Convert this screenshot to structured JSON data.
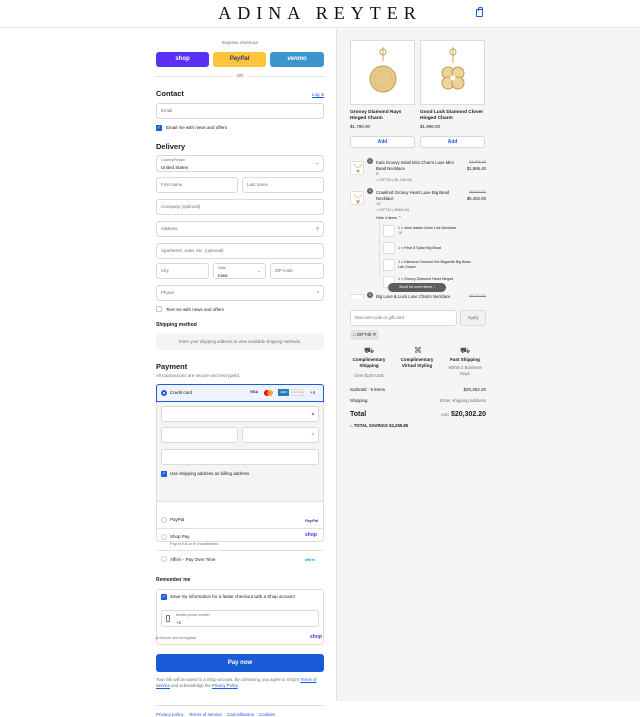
{
  "header": {
    "logo": "ADINA REYTER"
  },
  "express": {
    "label": "Express checkout",
    "shop": "shop",
    "paypal": "PayPal",
    "venmo": "venmo",
    "or": "OR"
  },
  "contact": {
    "title": "Contact",
    "login": "Log in",
    "email_placeholder": "Email",
    "news_label": "Email me with news and offers"
  },
  "delivery": {
    "title": "Delivery",
    "country_label": "Country/Region",
    "country_value": "United States",
    "first_name": "First name",
    "last_name": "Last name",
    "company": "Company (optional)",
    "address": "Address",
    "apartment": "Apartment, suite, etc. (optional)",
    "city": "City",
    "state_label": "State",
    "state_value": "Iowa",
    "zip": "ZIP code",
    "phone": "Phone",
    "text_label": "Text me with news and offers"
  },
  "shipping": {
    "title": "Shipping method",
    "notice": "Enter your shipping address to view available shipping methods."
  },
  "payment": {
    "title": "Payment",
    "subtitle": "All transactions are secure and encrypted.",
    "credit_card": "Credit card",
    "card_more": "+4",
    "billing_label": "Use shipping address as billing address",
    "paypal": "PayPal",
    "shop_pay": "Shop Pay",
    "shop_pay_sub": "Pay in full or in installments",
    "affirm": "Affirm - Pay Over Time",
    "brands": {
      "visa": "VISA",
      "amex": "AMEX",
      "discover": "DISCOVER",
      "shop": "shop",
      "affirm": "affirm"
    }
  },
  "remember": {
    "title": "Remember me",
    "save_label": "Save my information for a faster checkout with a Shop account",
    "mobile_label": "Mobile phone number",
    "mobile_value": "+1",
    "secure": "Secure and encrypted",
    "shop_brand": "shop"
  },
  "pay": {
    "label": "Pay now",
    "legal_1": "Your info will be saved to a Shop account. By continuing, you agree to Shop's",
    "terms": "Terms of Service",
    "legal_2": "and acknowledge the",
    "privacy": "Privacy Policy",
    "legal_end": "."
  },
  "footer": {
    "links": [
      "Privacy policy",
      "Terms of service",
      "Cancellations",
      "Cookies"
    ]
  },
  "upsells": [
    {
      "name": "Groovy Diamond Rays Hinged Charm",
      "price": "$1,798.00",
      "add": "Add"
    },
    {
      "name": "Good Luck Diamond Clover Hinged Charm",
      "price": "$1,998.00",
      "add": "Add"
    }
  ],
  "cart": [
    {
      "qty": "1",
      "name": "Kaia Groovy Initial Mini Charm Luxe Mini Bead Necklace",
      "variant": "B",
      "discount": "GIFT40 (-$1,208.00)",
      "old": "$3,098.00",
      "price": "$1,886.40"
    },
    {
      "qty": "1",
      "name": "Crawford Groovy Heart Luxe Big Bead Necklace",
      "variant": "16\"",
      "discount": "GIFT40 (-$968.20)",
      "old": "$6,553.00",
      "price": "$5,482.80"
    }
  ],
  "bundle": {
    "hide": "Hide 4 items",
    "items": [
      {
        "name": "1 × 4mm Italian Chain Link Necklace",
        "sub": "16\""
      },
      {
        "name": "1 × Pavé 8 Spike Big Bead",
        "sub": ""
      },
      {
        "name": "1 × Diamond Channel-Set Baguette Big Bead - Lab Grown",
        "sub": ""
      },
      {
        "name": "1 × Groovy Diamond Heart Hinged",
        "sub": ""
      }
    ],
    "scroll": "Scroll for more items"
  },
  "cart_last": {
    "qty": "1",
    "name": "Big Love & Luck Luxe Charm Necklace",
    "old": "$5,263.00"
  },
  "discount": {
    "placeholder": "Discount code or gift card",
    "apply": "Apply",
    "chip": "GIFT40"
  },
  "benefits": [
    {
      "title": "Complimentary Shipping",
      "sub": "Over $100 USD"
    },
    {
      "title": "Complimentary Virtual Styling",
      "sub": ""
    },
    {
      "title": "Fast Shipping",
      "sub": "Within 2 Business Days"
    }
  ],
  "summary": {
    "subtotal_label": "Subtotal · 5 items",
    "subtotal": "$20,302.20",
    "shipping_label": "Shipping",
    "shipping": "Enter shipping address",
    "total_label": "Total",
    "currency": "USD",
    "total": "$20,302.20",
    "savings_label": "TOTAL SAVINGS",
    "savings": "$2,255.80"
  },
  "colors": {
    "accent": "#1a5bd8",
    "shop": "#5a31f4",
    "paypal": "#ffc439",
    "venmo": "#3d95ce"
  }
}
